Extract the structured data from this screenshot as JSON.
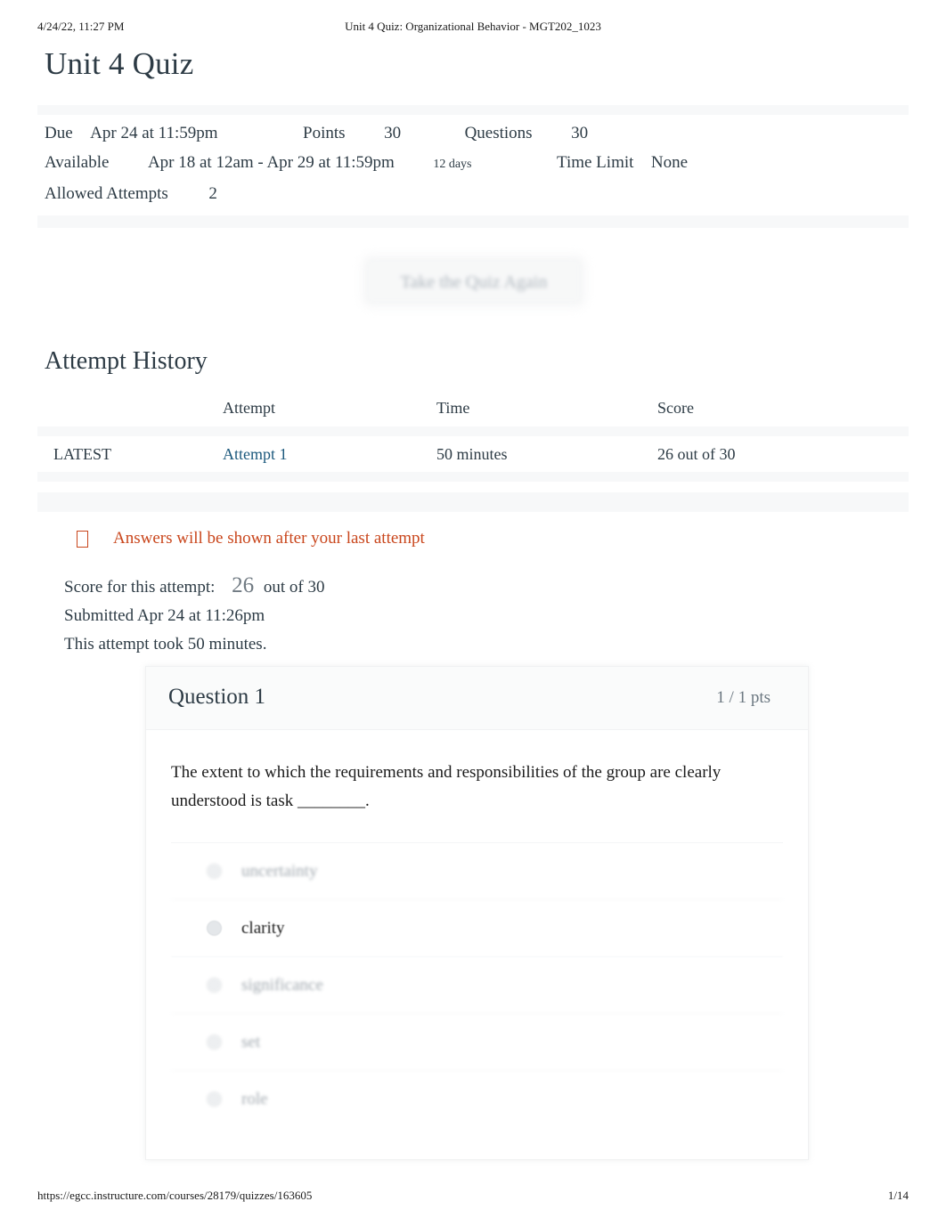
{
  "print": {
    "header_left": "4/24/22, 11:27 PM",
    "header_center": "Unit 4 Quiz: Organizational Behavior - MGT202_1023",
    "footer_url": "https://egcc.instructure.com/courses/28179/quizzes/163605",
    "footer_page": "1/14"
  },
  "page_title": "Unit 4 Quiz",
  "details": {
    "due_label": "Due",
    "due_value": "Apr 24 at 11:59pm",
    "points_label": "Points",
    "points_value": "30",
    "questions_label": "Questions",
    "questions_value": "30",
    "available_label": "Available",
    "available_value": "Apr 18 at 12am - Apr 29 at 11:59pm",
    "available_duration": "12 days",
    "time_limit_label": "Time Limit",
    "time_limit_value": "None",
    "allowed_attempts_label": "Allowed Attempts",
    "allowed_attempts_value": "2"
  },
  "retake_button_label": "Take the Quiz Again",
  "attempt_history": {
    "title": "Attempt History",
    "columns": [
      "",
      "Attempt",
      "Time",
      "Score"
    ],
    "rows": [
      {
        "tag": "LATEST",
        "attempt": "Attempt 1",
        "time": "50 minutes",
        "score": "26 out of 30"
      }
    ]
  },
  "warning": {
    "icon": "warning-icon",
    "text": "Answers will be shown after your last attempt"
  },
  "summary": {
    "score_label": "Score for this attempt:",
    "score_value": "26",
    "score_out_of": "out of 30",
    "submitted": "Submitted Apr 24 at 11:26pm",
    "duration": "This attempt took 50 minutes."
  },
  "question": {
    "title": "Question 1",
    "points": "1 / 1 pts",
    "text": "The extent to which the requirements and responsibilities of the group are clearly understood is task ________.",
    "answers": [
      {
        "label": "uncertainty",
        "selected": false
      },
      {
        "label": "clarity",
        "selected": true
      },
      {
        "label": "significance",
        "selected": false
      },
      {
        "label": "set",
        "selected": false
      },
      {
        "label": "role",
        "selected": false
      }
    ]
  },
  "colors": {
    "link": "#1b587c",
    "warning": "#c9461c",
    "text": "#2d3b45",
    "muted": "#9aa2a9",
    "band": "#f7f8f9"
  }
}
